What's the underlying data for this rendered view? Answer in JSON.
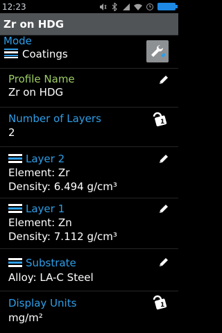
{
  "status": {
    "time": "12:23"
  },
  "header": {
    "title": "Zr on HDG"
  },
  "mode": {
    "label": "Mode",
    "value": "Coatings"
  },
  "profile": {
    "label": "Profile Name",
    "value": "Zr on HDG"
  },
  "layers_count": {
    "label": "Number of Layers",
    "value": "2"
  },
  "layer2": {
    "label": "Layer 2",
    "element": "Element: Zr",
    "density": "Density: 6.494 g/cm³"
  },
  "layer1": {
    "label": "Layer 1",
    "element": "Element: Zn",
    "density": "Density: 7.112 g/cm³"
  },
  "substrate": {
    "label": "Substrate",
    "alloy": "Alloy: LA-C Steel"
  },
  "units": {
    "label": "Display Units",
    "value": "mg/m²"
  },
  "colors": {
    "accent_blue": "#2e9ee8",
    "accent_green": "#9ccc65",
    "titlebar": "#505457"
  },
  "icons": {
    "edit": "pencil-icon",
    "lock": "lock-icon",
    "mode": "wrench-icon",
    "layers": "stack-icon"
  }
}
